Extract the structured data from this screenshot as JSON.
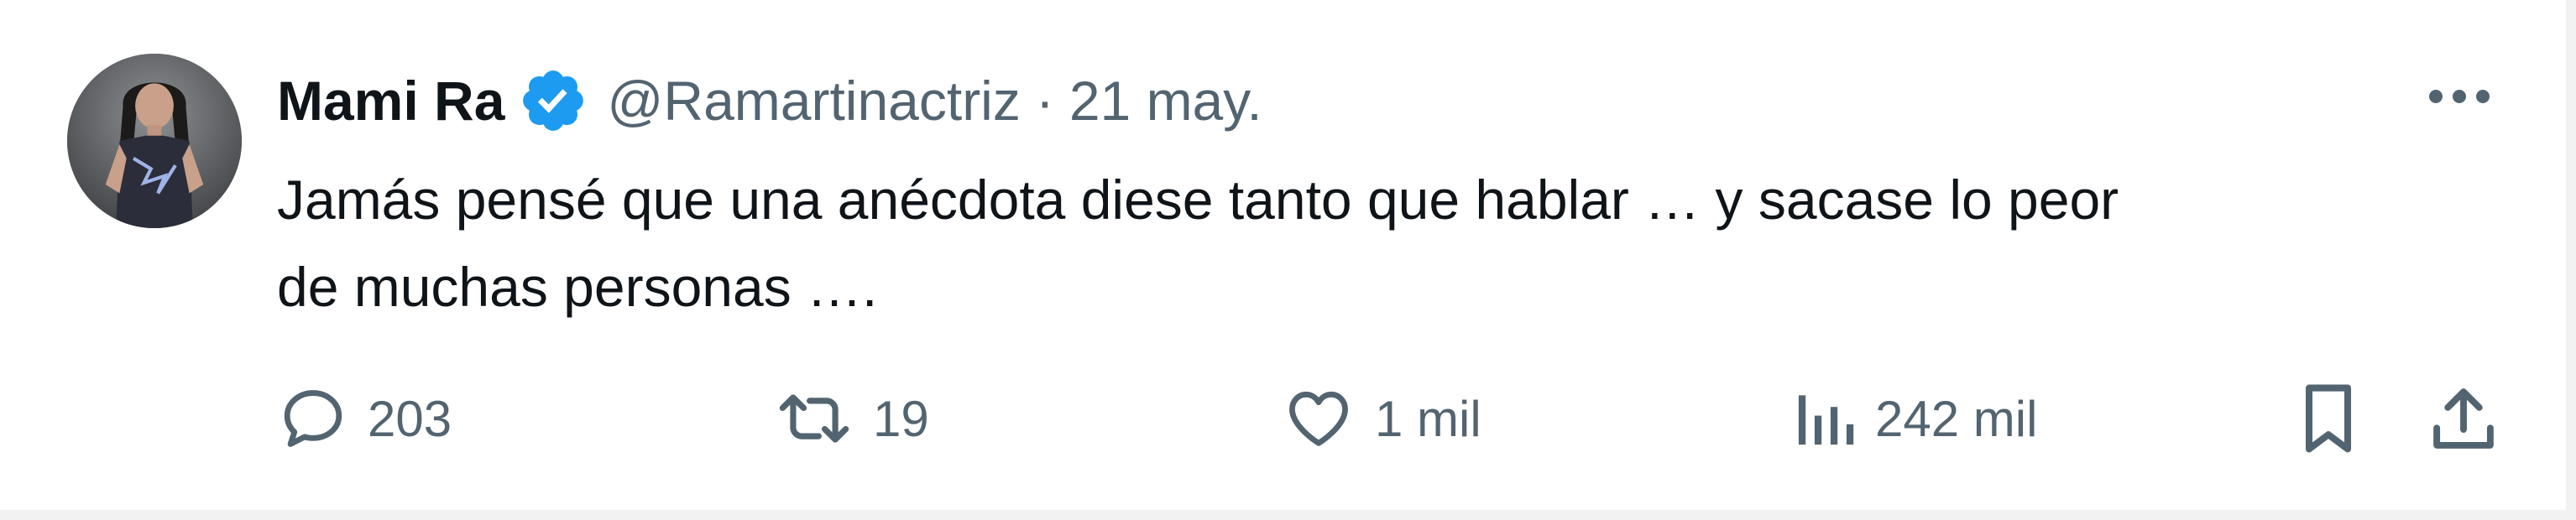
{
  "tweet": {
    "author": {
      "display_name": "Mami Ra",
      "verified": true,
      "handle": "@Ramartinactriz",
      "separator": "·",
      "date": "21 may."
    },
    "text_lines": [
      "Jamás pensé que una anécdota diese tanto que hablar … y sacase lo peor",
      "de muchas personas …."
    ],
    "actions": {
      "replies": "203",
      "retweets": "19",
      "likes": "1 mil",
      "views": "242 mil"
    },
    "colors": {
      "text": "#0f1419",
      "secondary": "#536471",
      "verified": "#1d9bf0"
    },
    "icons": {
      "verified": "verified-badge-icon",
      "more": "more-options-icon",
      "reply": "reply-icon",
      "retweet": "retweet-icon",
      "like": "heart-icon",
      "views": "analytics-icon",
      "bookmark": "bookmark-icon",
      "share": "share-icon"
    }
  }
}
